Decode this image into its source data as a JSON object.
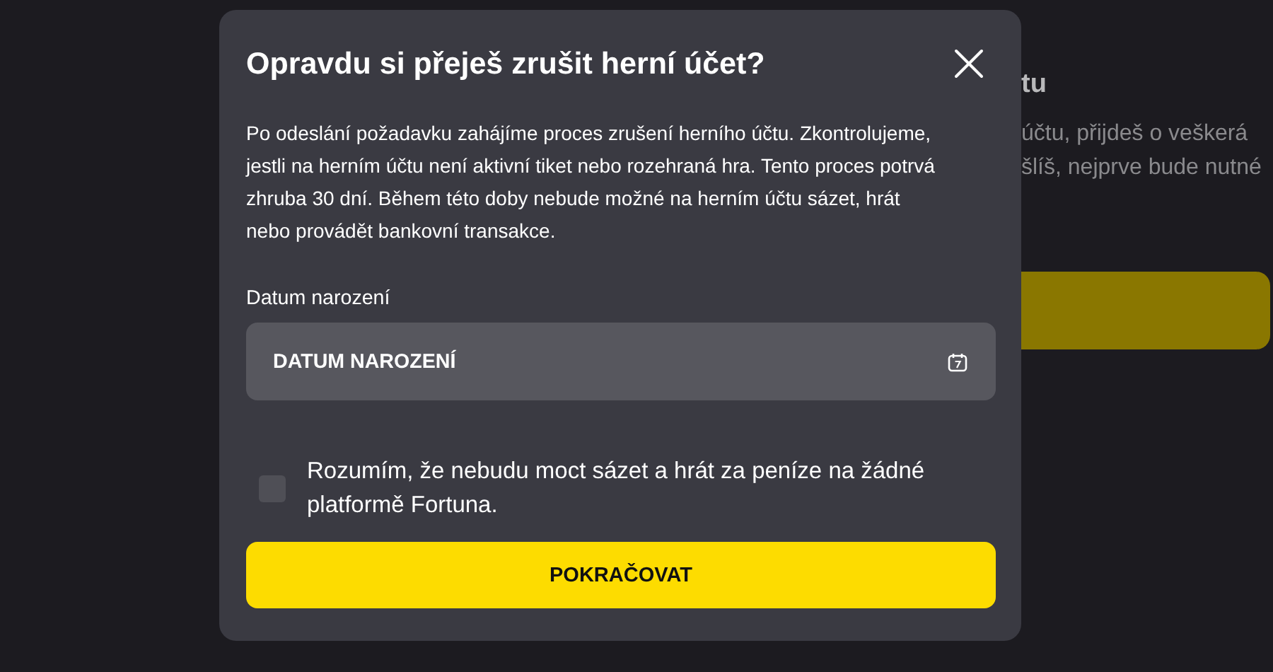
{
  "background_page": {
    "heading": "tu",
    "text_lines": [
      "účtu, přijdeš o veškerá",
      "šlíš, nejprve bude nutné"
    ]
  },
  "dialog": {
    "title": "Opravdu si přeješ zrušit herní účet?",
    "description": "Po odeslání požadavku zahájíme proces zrušení herního účtu. Zkontrolujeme, jestli na herním účtu není aktivní tiket nebo rozehraná hra. Tento proces potrvá zhruba 30 dní. Během této doby nebude možné na herním účtu sázet, hrát nebo provádět bankovní transakce.",
    "date_field": {
      "label": "Datum narození",
      "placeholder": "DATUM NAROZENÍ"
    },
    "consent": {
      "checked": false,
      "label": "Rozumím, že nebudu moct sázet a hrát za peníze na žádné platformě Fortuna."
    },
    "submit_button": "POKRAČOVAT"
  }
}
